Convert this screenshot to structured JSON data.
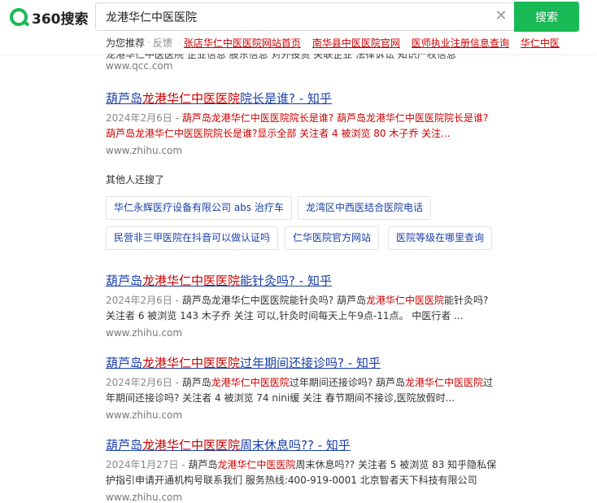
{
  "header": {
    "logo_text": "360搜索",
    "search_value": "龙港华仁中医医院",
    "clear_glyph": "✕",
    "search_button": "搜索",
    "suggest_label": "为您推荐",
    "suggest_sep": "·",
    "suggest_feedback": "反馈",
    "suggestions": [
      "张店华仁中医医院网站首页",
      "南华县中医医院官网",
      "医师执业注册信息查询",
      "华仁中医"
    ]
  },
  "top_fragment": {
    "snippet": "龙港华仁中医医院 企业信息 股东信息 对外投资 关联企业 法律诉讼 知识产权信息",
    "url": "www.qcc.com"
  },
  "results": [
    {
      "title_prefix": "葫芦岛",
      "title_hl": "龙港华仁中医医院",
      "title_suffix": "院长是谁? - 知乎",
      "date": "2024年2月6日 - ",
      "snippet": "葫芦岛龙港华仁中医医院院长是谁? 葫芦岛龙港华仁中医医院院长是谁? 葫芦岛龙港华仁中医医院院长是谁?显示全部  关注者 4 被浏览 80 木子乔  关注...",
      "url": "www.zhihu.com"
    },
    {
      "title_prefix": "葫芦岛",
      "title_hl": "龙港华仁中医医院",
      "title_suffix": "能针灸吗? - 知乎",
      "date": "2024年2月6日 - ",
      "snippet_pre": "葫芦岛龙港华仁中医医院能针灸吗? 葫芦岛",
      "snippet_hl": "龙港华仁中医医院",
      "snippet_post": "能针灸吗? 关注者 6 被浏览 143 木子乔  关注 可以,针灸时间每天上午9点-11点。 中医行者 ...",
      "url": "www.zhihu.com"
    },
    {
      "title_prefix": "葫芦岛",
      "title_hl": "龙港华仁中医医院",
      "title_suffix": "过年期间还接诊吗? - 知乎",
      "date": "2024年2月6日 - ",
      "snippet_pre": "葫芦岛",
      "snippet_hl": "龙港华仁中医医院",
      "snippet_mid": "过年期间还接诊吗? 葫芦岛",
      "snippet_hl2": "龙港华仁中医医院",
      "snippet_post": "过年期间还接诊吗? 关注者 4 被浏览 74 nini缓  关注 春节期间不接诊,医院放假时...",
      "url": "www.zhihu.com"
    },
    {
      "title_prefix": "葫芦岛",
      "title_hl": "龙港华仁中医医院",
      "title_suffix": "周末休息吗?? - 知乎",
      "date": "2024年1月27日 - ",
      "snippet_pre": "葫芦岛",
      "snippet_hl": "龙港华仁中医医院",
      "snippet_post": "周末休息吗?? 关注者 5 被浏览 83 知乎隐私保护指引申请开通机构号联系我们 服务热线:400-919-0001 北京智者天下科技有限公司",
      "url": "www.zhihu.com"
    }
  ],
  "related": {
    "heading": "其他人还搜了",
    "row1": [
      "华仁永辉医疗设备有限公司 abs 治疗车",
      "龙湾区中西医结合医院电话"
    ],
    "row2": [
      "民营非三甲医院在抖音可以做认证吗",
      "仁华医院官方网站",
      "医院等级在哪里查询"
    ]
  },
  "colors": {
    "brand_green": "#19b955",
    "link_blue": "#1a3ea8",
    "highlight_red": "#cc0000",
    "url_gray": "#777777"
  }
}
